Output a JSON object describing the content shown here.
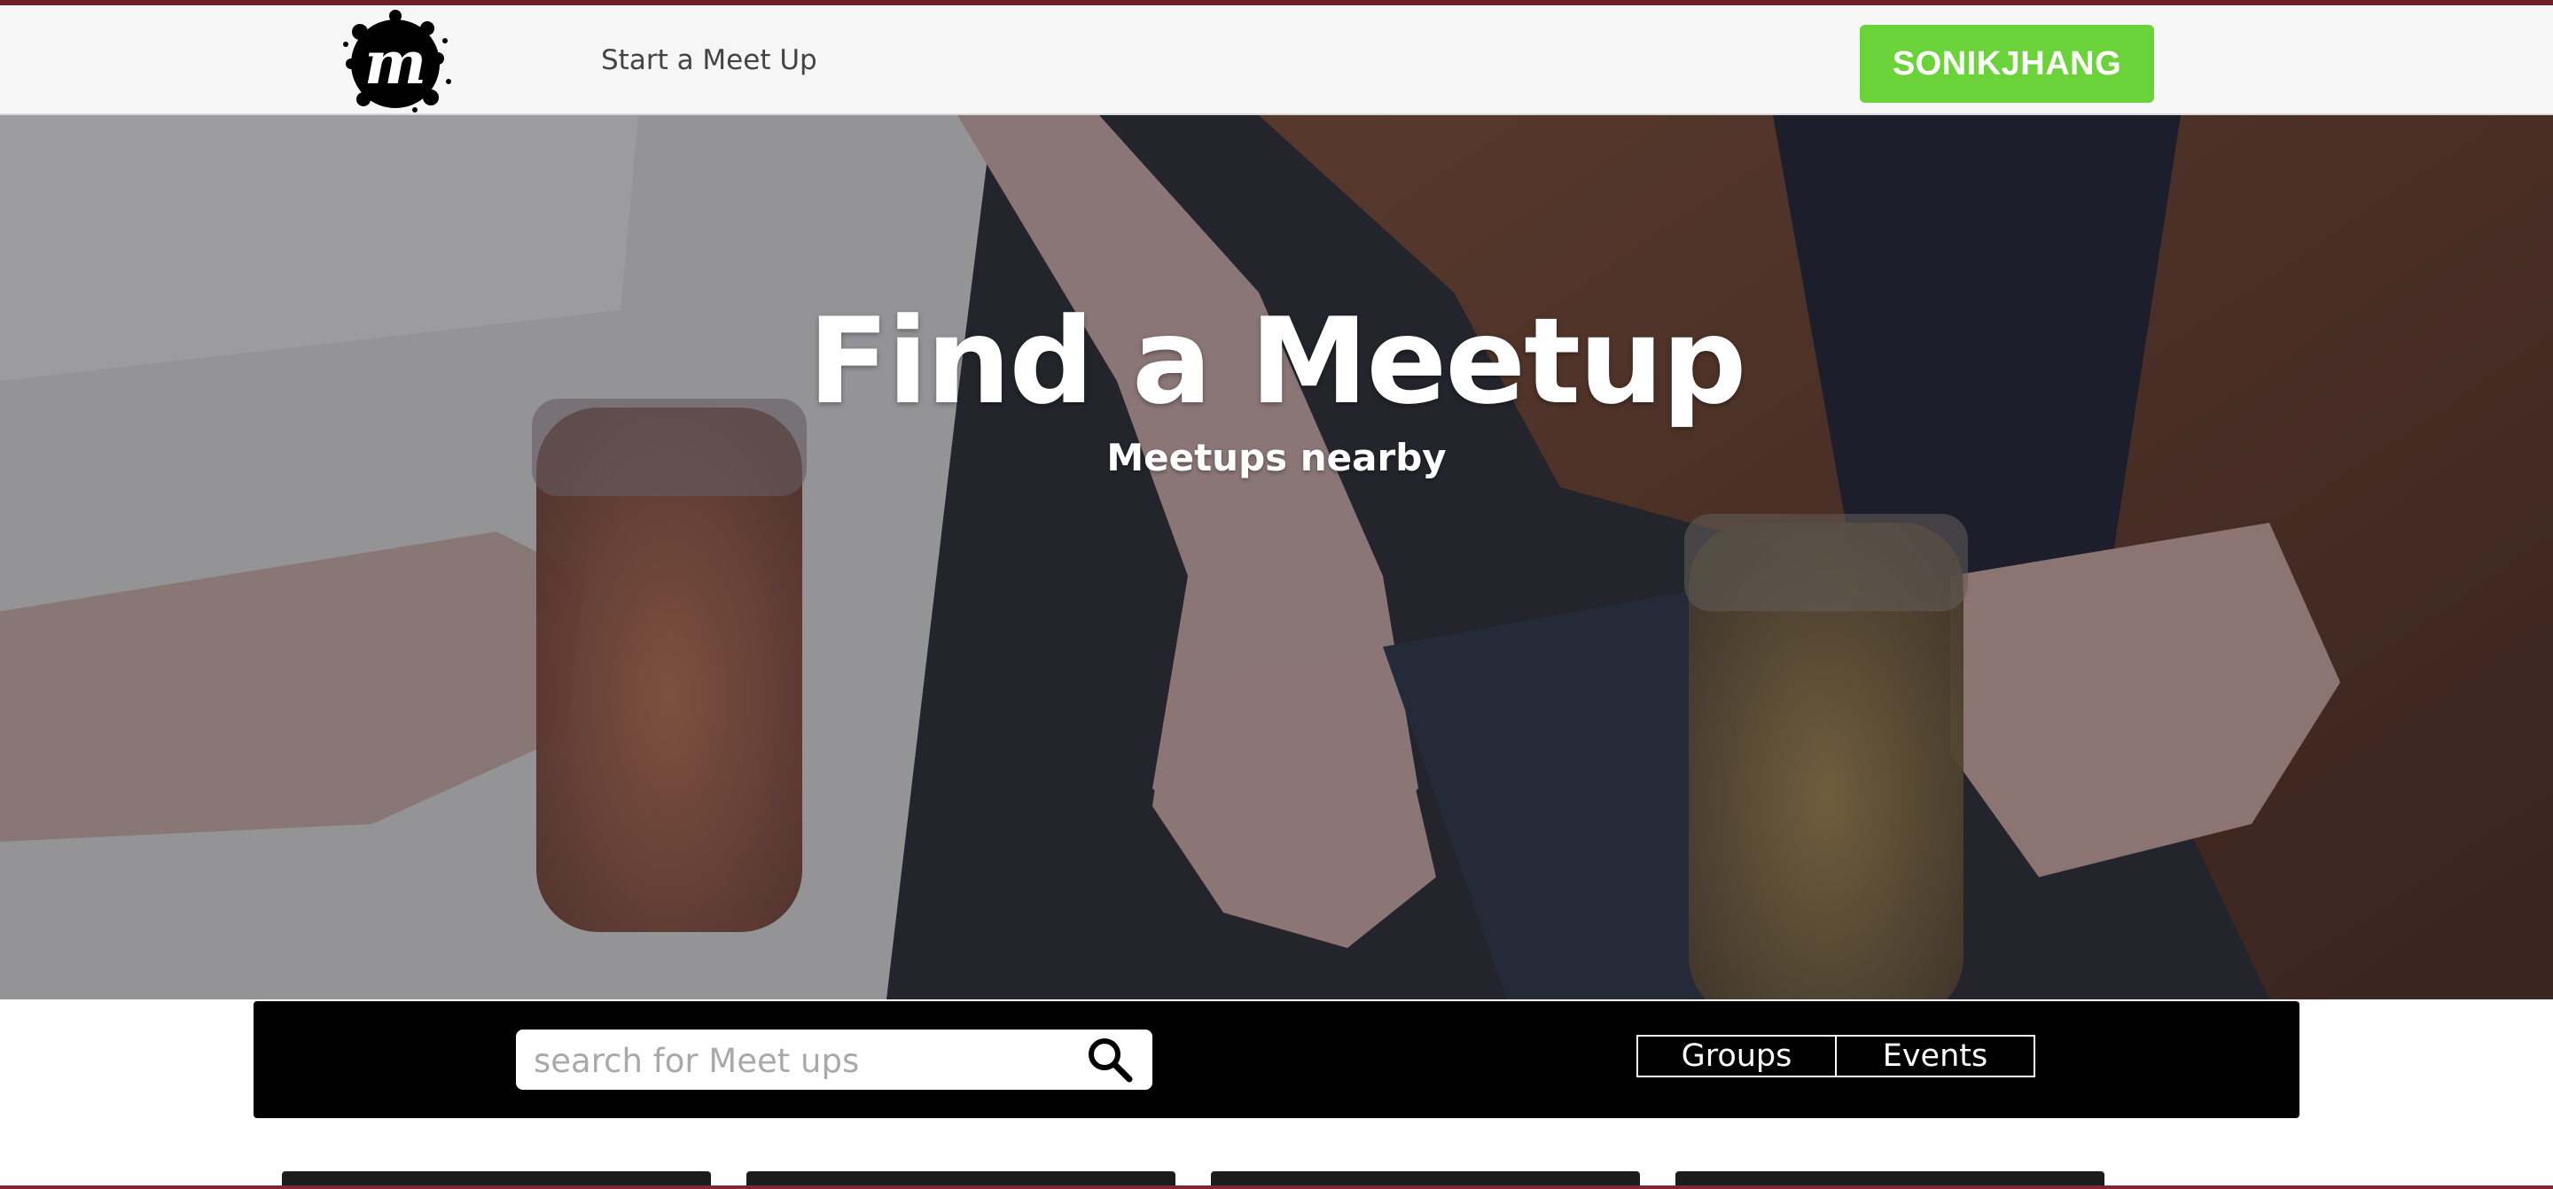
{
  "header": {
    "logo_letter": "m",
    "start_label": "Start a Meet Up",
    "user_button": "SONIKJHANG"
  },
  "hero": {
    "title": "Find a Meetup",
    "subtitle": "Meetups nearby"
  },
  "search": {
    "placeholder": "search for Meet ups",
    "value": ""
  },
  "tabs": [
    {
      "label": "Groups"
    },
    {
      "label": "Events"
    }
  ],
  "colors": {
    "accent_green": "#6bd33a",
    "frame": "#6e1f28",
    "header_bg": "#f6f6f6",
    "bar_bg": "#000000"
  },
  "icons": [
    "meetup-logo",
    "search-icon"
  ]
}
